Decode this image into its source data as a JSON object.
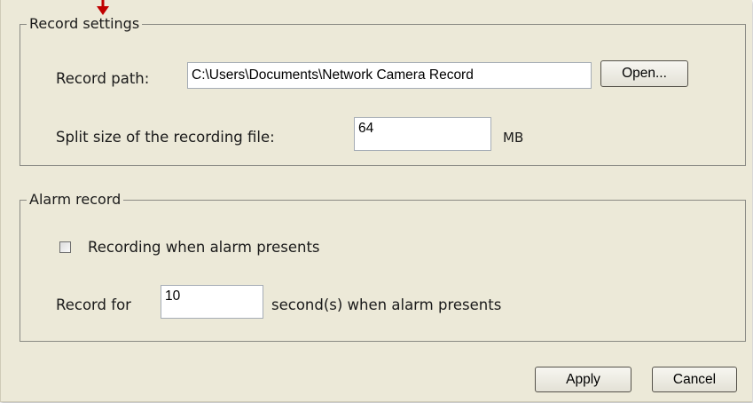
{
  "record_settings": {
    "title": "Record settings",
    "record_path_label": "Record path:",
    "record_path_value": "C:\\Users\\Documents\\Network Camera Record",
    "open_button_label": "Open...",
    "split_size_label": "Split size of the recording file:",
    "split_size_value": "64",
    "split_size_unit": "MB"
  },
  "alarm_record": {
    "title": "Alarm record",
    "checkbox_label": "Recording when alarm presents",
    "checkbox_checked": false,
    "record_for_label": "Record for",
    "record_for_value": "10",
    "record_for_suffix": "second(s) when alarm presents"
  },
  "footer": {
    "apply_label": "Apply",
    "cancel_label": "Cancel"
  },
  "colors": {
    "panel_background": "#ece9d8",
    "annotation_arrow": "#c00000"
  },
  "icons": [
    "annotation-arrow-icon",
    "checkbox"
  ]
}
